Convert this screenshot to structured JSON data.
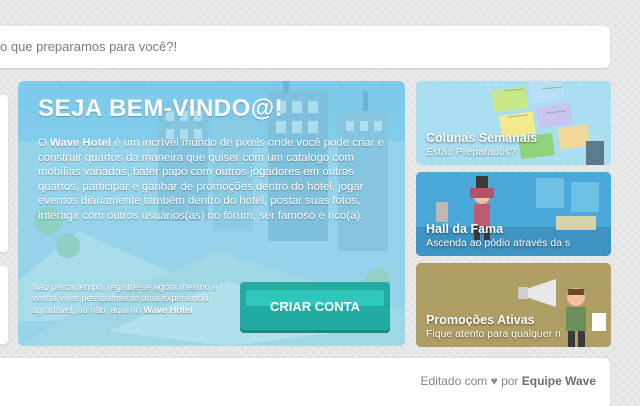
{
  "topbar": {
    "text": "o que preparamos para você?!"
  },
  "hero": {
    "title": "SEJA BEM-VINDO@!",
    "desc_prefix": "O ",
    "desc_brand": "Wave Hotel",
    "desc_body": " é um incrível mundo de pixels onde você pode criar e construir quartos da maneira que quiser com um catalogo com mobílias variadas, bater papo com outros jogadores em outros quartos, participar e ganhar de promoções dentro do hotel, jogar eventos diariamente também dentro do hotel, postar suas fotos, interagir com outros usuários(as) no fórum, ser famoso e rico(a).",
    "sub_body": "Não perca tempo, registre-se agora mesmo e venha viver pessoalmente uma experiência agradável, ou não, aqui no ",
    "sub_brand": "Wave Hotel",
    "cta_label": "CRIAR CONTA"
  },
  "side_cards": [
    {
      "title": "Colunas Semanais",
      "subtitle": "Estão Preparados?",
      "bg": "#a9dff1"
    },
    {
      "title": "Hall da Fama",
      "subtitle": "Ascenda ao pódio através da s",
      "bg": "#4aa9d8"
    },
    {
      "title": "Promoções Ativas",
      "subtitle": "Fique atento para qualquer n",
      "bg": "#b5a36a"
    }
  ],
  "footer": {
    "prefix": "Editado com",
    "heart_icon": "heart-icon",
    "by": "por",
    "author": "Equipe Wave"
  },
  "colors": {
    "cta": "#24aba0",
    "hero_bg": "#7cc9ea"
  }
}
